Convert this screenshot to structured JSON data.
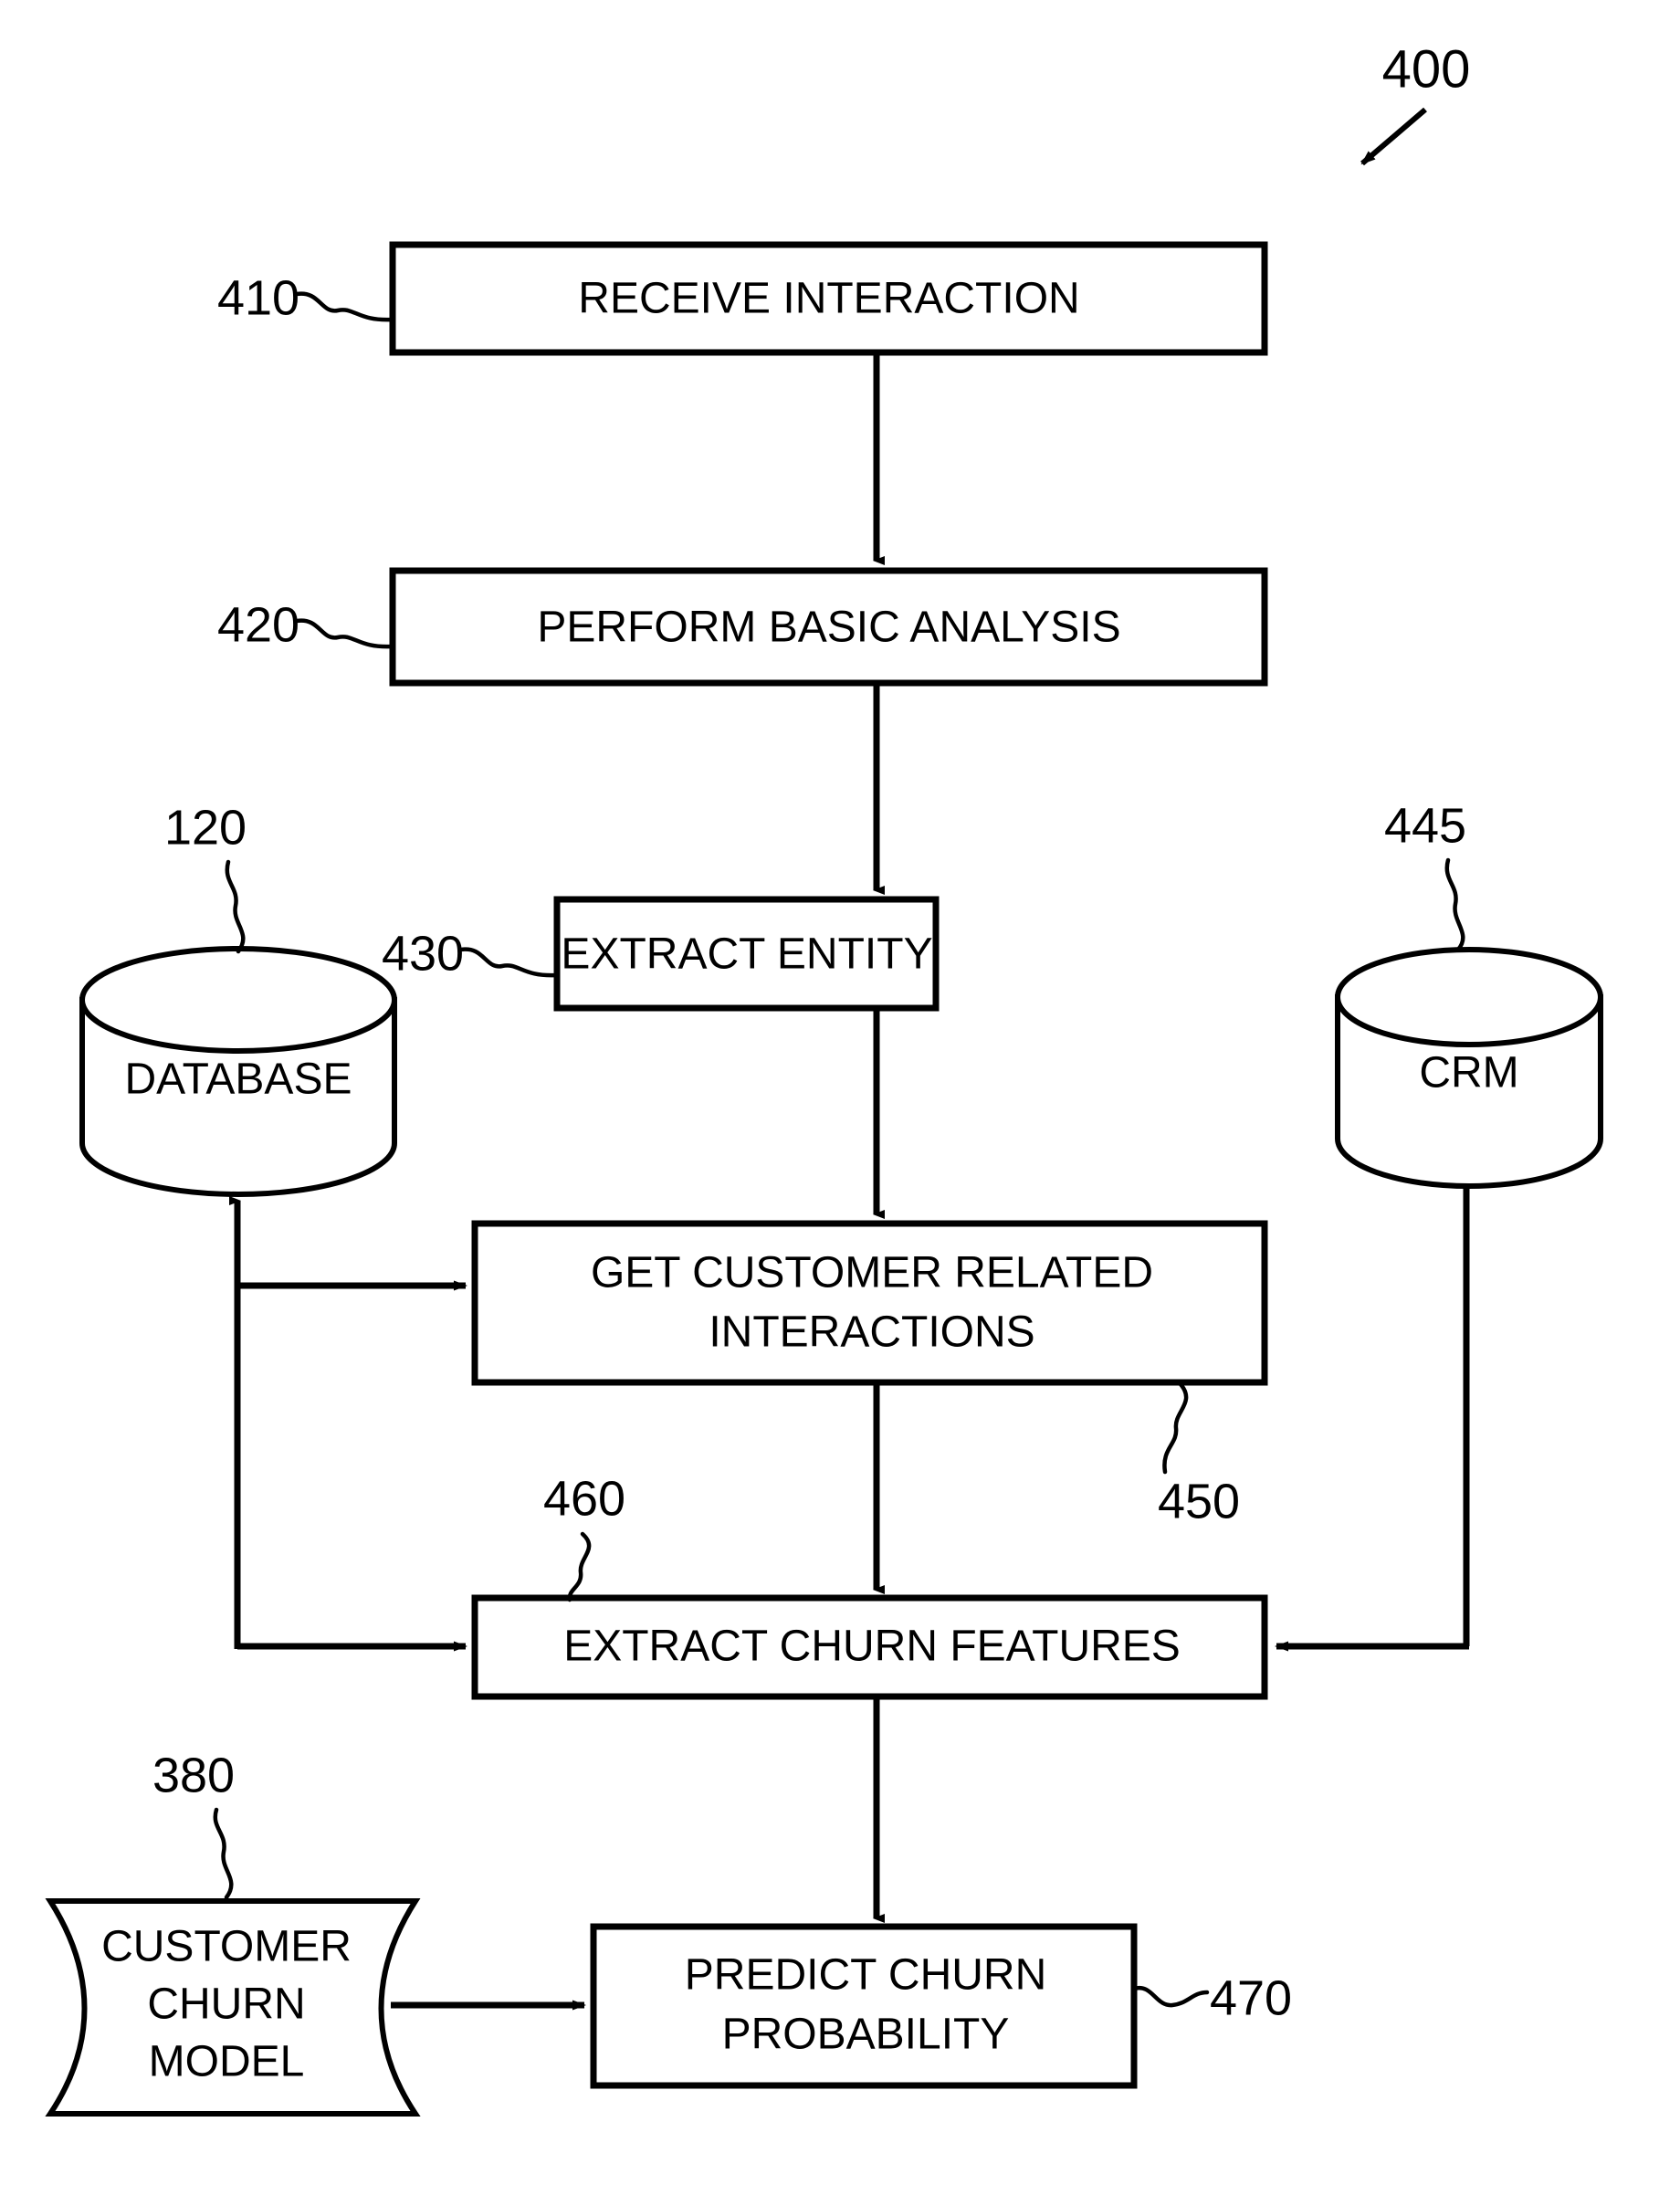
{
  "figure": {
    "number": "400"
  },
  "process_boxes": [
    {
      "ref": "410",
      "label": "RECEIVE INTERACTION",
      "lines": [
        "RECEIVE INTERACTION"
      ]
    },
    {
      "ref": "420",
      "label": "PERFORM BASIC ANALYSIS",
      "lines": [
        "PERFORM BASIC ANALYSIS"
      ]
    },
    {
      "ref": "430",
      "label": "EXTRACT ENTITY",
      "lines": [
        "EXTRACT ENTITY"
      ]
    },
    {
      "ref": "450",
      "label": "GET CUSTOMER RELATED INTERACTIONS",
      "lines": [
        "GET CUSTOMER RELATED",
        "INTERACTIONS"
      ]
    },
    {
      "ref": "460",
      "label": "EXTRACT CHURN FEATURES",
      "lines": [
        "EXTRACT CHURN FEATURES"
      ]
    },
    {
      "ref": "470",
      "label": "PREDICT CHURN PROBABILITY",
      "lines": [
        "PREDICT CHURN",
        "PROBABILITY"
      ]
    }
  ],
  "data_stores": [
    {
      "ref": "120",
      "label": "DATABASE",
      "shape": "cylinder"
    },
    {
      "ref": "445",
      "label": "CRM",
      "shape": "cylinder"
    },
    {
      "ref": "380",
      "label": "CUSTOMER CHURN MODEL",
      "lines": [
        "CUSTOMER",
        "CHURN",
        "MODEL"
      ],
      "shape": "tape"
    }
  ],
  "refs": {
    "fig": "400",
    "r410": "410",
    "r420": "420",
    "r430": "430",
    "r445": "445",
    "r450": "450",
    "r460": "460",
    "r470": "470",
    "r120": "120",
    "r380": "380"
  },
  "box_text": {
    "b410_l1": "RECEIVE INTERACTION",
    "b420_l1": "PERFORM BASIC ANALYSIS",
    "b430_l1": "EXTRACT ENTITY",
    "b450_l1": "GET CUSTOMER RELATED",
    "b450_l2": "INTERACTIONS",
    "b460_l1": "EXTRACT CHURN FEATURES",
    "b470_l1": "PREDICT CHURN",
    "b470_l2": "PROBABILITY"
  },
  "store_text": {
    "database": "DATABASE",
    "crm": "CRM",
    "model_l1": "CUSTOMER",
    "model_l2": "CHURN",
    "model_l3": "MODEL"
  },
  "colors": {
    "stroke": "#000000",
    "fill": "#ffffff",
    "background": "#ffffff"
  }
}
